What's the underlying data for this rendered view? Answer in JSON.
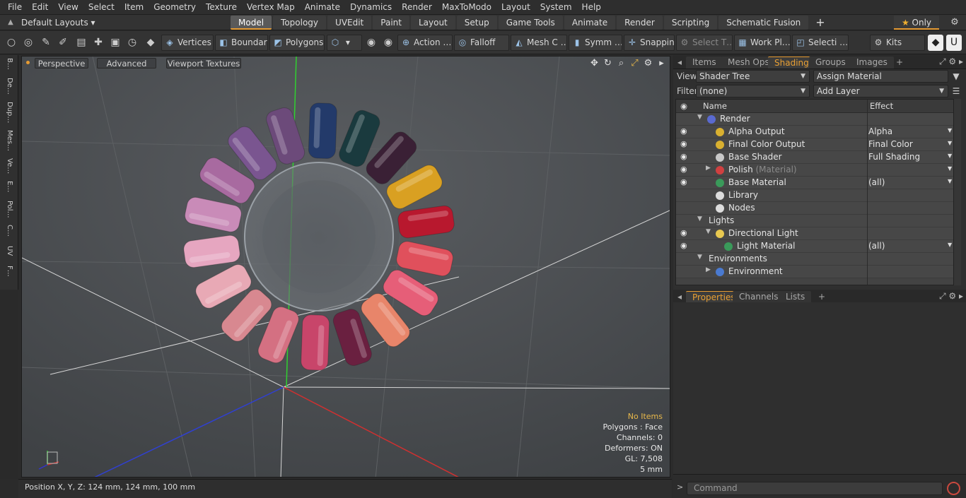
{
  "menubar": [
    "File",
    "Edit",
    "View",
    "Select",
    "Item",
    "Geometry",
    "Texture",
    "Vertex Map",
    "Animate",
    "Dynamics",
    "Render",
    "MaxToModo",
    "Layout",
    "System",
    "Help"
  ],
  "layoutbar": {
    "default_layouts": "Default Layouts ▾",
    "tabs": [
      "Model",
      "Topology",
      "UVEdit",
      "Paint",
      "Layout",
      "Setup",
      "Game Tools",
      "Animate",
      "Render",
      "Scripting",
      "Schematic Fusion"
    ],
    "active_tab": "Model",
    "only_label": "Only"
  },
  "toolbar": {
    "vertices": "Vertices",
    "boundary": "Boundary",
    "polygons": "Polygons",
    "action": "Action",
    "falloff": "Falloff",
    "mesh": "Mesh C …",
    "symm": "Symm …",
    "snapping": "Snapping",
    "select_t": "Select T…",
    "work_pl": "Work Pl…",
    "selecti": "Selecti …",
    "kits": "Kits"
  },
  "left_tabs": [
    "B…",
    "De…",
    "Dup…",
    "Mes…",
    "Ve…",
    "E…",
    "Pol…",
    "C…",
    "UV",
    "F…"
  ],
  "viewport": {
    "perspective": "Perspective",
    "advanced": "Advanced",
    "textures": "Viewport Textures",
    "info": {
      "no_items": "No Items",
      "polygons": "Polygons : Face",
      "channels": "Channels: 0",
      "deformers": "Deformers: ON",
      "gl": "GL: 7,508",
      "size": "5 mm"
    },
    "swatch_colors": [
      "#233a6a",
      "#1a3a3e",
      "#3a2035",
      "#d9a022",
      "#b8182e",
      "#e0505c",
      "#e65e78",
      "#e8856a",
      "#6a2040",
      "#c8456a",
      "#d47082",
      "#d88890",
      "#e8a9b5",
      "#e6a6c0",
      "#c98bb8",
      "#a86aa0",
      "#7a5590",
      "#6c4a7a"
    ]
  },
  "status": {
    "position": "Position X, Y, Z:   124 mm,  124 mm,  100 mm"
  },
  "right_panel": {
    "top_tabs": [
      "Items",
      "Mesh Ops",
      "Shading",
      "Groups",
      "Images"
    ],
    "active_top_tab": "Shading",
    "view_label": "View",
    "view_value": "Shader Tree",
    "assign_material": "Assign Material",
    "filter_label": "Filter",
    "filter_value": "(none)",
    "add_layer": "Add Layer",
    "col_name": "Name",
    "col_effect": "Effect",
    "tree": [
      {
        "name": "Render",
        "sub": "",
        "effect": "",
        "eye": false,
        "indent": 0,
        "tri": "▼",
        "icon": "#5a6ad0"
      },
      {
        "name": "Alpha Output",
        "sub": "",
        "effect": "Alpha",
        "eye": true,
        "indent": 1,
        "tri": "",
        "icon": "#d9b030"
      },
      {
        "name": "Final Color Output",
        "sub": "",
        "effect": "Final Color",
        "eye": true,
        "indent": 1,
        "tri": "",
        "icon": "#d9b030"
      },
      {
        "name": "Base Shader",
        "sub": "",
        "effect": "Full Shading",
        "eye": true,
        "indent": 1,
        "tri": "",
        "icon": "#c8c8c8"
      },
      {
        "name": "Polish",
        "sub": " (Material)",
        "effect": "",
        "eye": true,
        "indent": 1,
        "tri": "▶",
        "icon": "#d04040"
      },
      {
        "name": "Base Material",
        "sub": "",
        "effect": "(all)",
        "eye": true,
        "indent": 1,
        "tri": "",
        "icon": "#3a9a5a"
      },
      {
        "name": "Library",
        "sub": "",
        "effect": "",
        "eye": false,
        "indent": 1,
        "tri": "",
        "icon": "#dddddd"
      },
      {
        "name": "Nodes",
        "sub": "",
        "effect": "",
        "eye": false,
        "indent": 1,
        "tri": "",
        "icon": "#dddddd"
      },
      {
        "name": "Lights",
        "sub": "",
        "effect": "",
        "eye": false,
        "indent": 0,
        "tri": "▼",
        "icon": ""
      },
      {
        "name": "Directional Light",
        "sub": "",
        "effect": "",
        "eye": true,
        "indent": 1,
        "tri": "▼",
        "icon": "#e8c850"
      },
      {
        "name": "Light Material",
        "sub": "",
        "effect": "(all)",
        "eye": true,
        "indent": 2,
        "tri": "",
        "icon": "#3a9a5a"
      },
      {
        "name": "Environments",
        "sub": "",
        "effect": "",
        "eye": false,
        "indent": 0,
        "tri": "▼",
        "icon": ""
      },
      {
        "name": "Environment",
        "sub": "",
        "effect": "",
        "eye": false,
        "indent": 1,
        "tri": "▶",
        "icon": "#4a7ad0"
      }
    ],
    "bottom_tabs": [
      "Properties",
      "Channels",
      "Lists"
    ],
    "active_bottom_tab": "Properties",
    "command_placeholder": "Command"
  }
}
